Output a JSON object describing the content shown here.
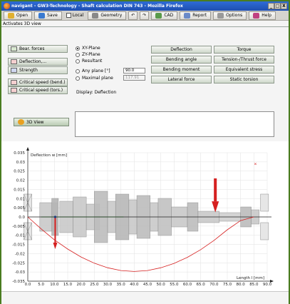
{
  "window": {
    "title": "navigant - GW3-Technology - Shaft calculation DIN 743 - Mozilla Firefox",
    "controls": [
      "_",
      "□",
      "X"
    ]
  },
  "toolbar": {
    "open": "Open",
    "save": "Save",
    "local": "Local",
    "geometry": "Geometry",
    "undo": "↶",
    "redo": "↷",
    "cad": "CAD",
    "report": "Report",
    "options": "Options",
    "help": "Help"
  },
  "status": "Activates 3D view",
  "left_buttons": [
    "Bear. forces",
    "Deflection,...",
    "Strength",
    "Critical speed (bend.)",
    "Critical speed (tors.)"
  ],
  "planes": {
    "xy": "XY-Plane",
    "zy": "ZY-Plane",
    "resultant": "Resultant",
    "any": "Any plane [°]",
    "any_value": "90.0",
    "maximal": "Maximal plane",
    "maximal_value": "117.91",
    "selected": "XY-Plane"
  },
  "display": "Display: Deflection",
  "results": {
    "col1": [
      "Deflection",
      "Bending angle",
      "Bending moment",
      "Lateral force"
    ],
    "col2": [
      "Torque",
      "Tension-/Thrust force",
      "Equivalent stress",
      "Static torsion"
    ]
  },
  "view3d": "3D View",
  "chart_data": {
    "type": "line",
    "ylabel": "Deflection w [mm]",
    "xlabel": "Length l [mm]",
    "xlim": [
      0,
      90
    ],
    "ylim": [
      -0.035,
      0.035
    ],
    "x_ticks": [
      "0.0",
      "5.0",
      "10.0",
      "15.0",
      "20.0",
      "25.0",
      "30.0",
      "35.0",
      "40.0",
      "45.0",
      "50.0",
      "55.0",
      "60.0",
      "65.0",
      "70.0",
      "75.0",
      "80.0",
      "85.0",
      "90.0"
    ],
    "y_ticks": [
      "0.035",
      "0.03",
      "0.025",
      "0.02",
      "0.015",
      "0.01",
      "0.005",
      "0.0",
      "-0.005",
      "-0.01",
      "-0.015",
      "-0.02",
      "-0.025",
      "-0.03",
      "-0.035"
    ],
    "series": [
      {
        "color": "#d62020",
        "x": [
          0,
          5,
          10,
          15,
          20,
          25,
          30,
          35,
          40,
          45,
          50,
          55,
          60,
          65,
          70,
          75,
          80,
          85
        ],
        "y": [
          0.0,
          -0.0065,
          -0.0125,
          -0.0175,
          -0.0218,
          -0.0252,
          -0.0277,
          -0.0292,
          -0.0297,
          -0.0292,
          -0.0277,
          -0.0253,
          -0.022,
          -0.0178,
          -0.0128,
          -0.007,
          -0.002,
          0.0
        ]
      }
    ]
  },
  "colors": {
    "titlebar": "#1f4fb0",
    "window_border": "#4a7c20",
    "curve": "#d62020",
    "load_arrow": "#d62020"
  }
}
